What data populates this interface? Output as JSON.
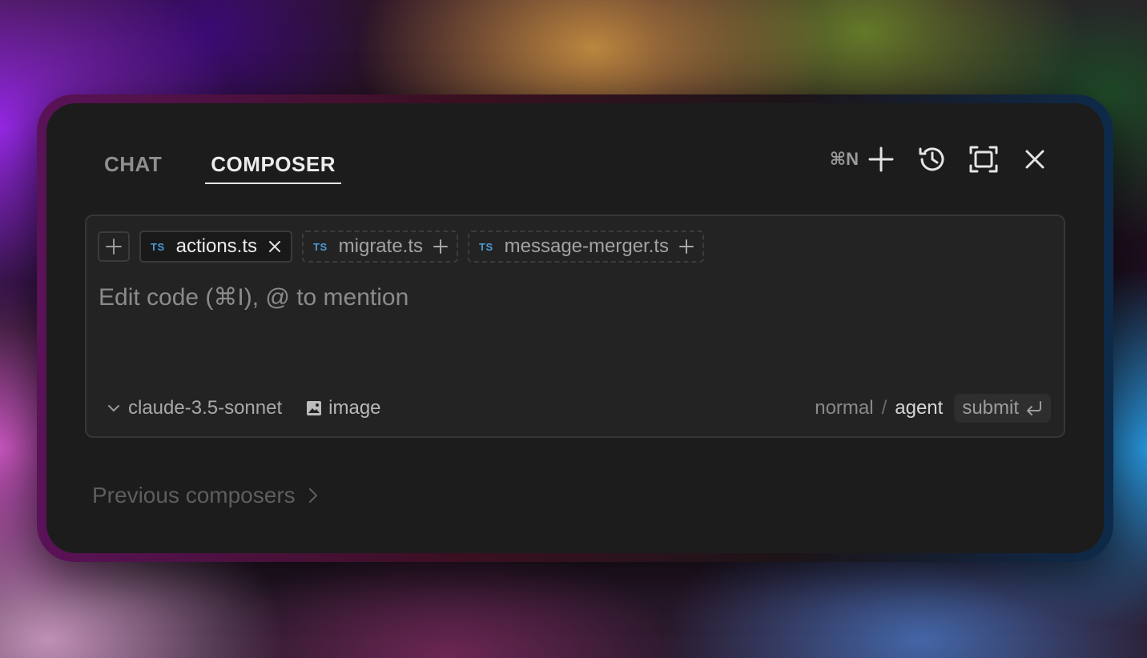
{
  "tabs": [
    {
      "label": "CHAT",
      "active": false
    },
    {
      "label": "COMPOSER",
      "active": true
    }
  ],
  "header": {
    "new_shortcut": "⌘N",
    "icons": [
      "plus-icon",
      "history-icon",
      "expand-icon",
      "close-icon"
    ]
  },
  "context_chips": [
    {
      "badge": "TS",
      "name": "actions.ts",
      "state": "attached",
      "action_icon": "close-icon"
    },
    {
      "badge": "TS",
      "name": "migrate.ts",
      "state": "suggested",
      "action_icon": "plus-icon"
    },
    {
      "badge": "TS",
      "name": "message-merger.ts",
      "state": "suggested",
      "action_icon": "plus-icon"
    }
  ],
  "input": {
    "placeholder": "Edit code (⌘I), @ to mention"
  },
  "footer": {
    "model": "claude-3.5-sonnet",
    "image_label": "image",
    "mode_normal": "normal",
    "mode_separator": "/",
    "mode_agent": "agent",
    "submit_label": "submit"
  },
  "previous_composers": {
    "label": "Previous composers"
  },
  "colors": {
    "panel_bg": "#1c1c1c",
    "composer_bg": "#232323",
    "ts_badge": "#4b9bd6",
    "active_text": "#ececec",
    "muted_text": "#8f8f8f"
  }
}
